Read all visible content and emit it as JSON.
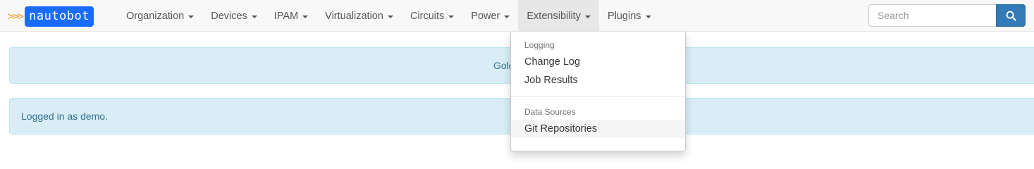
{
  "brand": {
    "chevrons": ">>>",
    "name": "nautobot"
  },
  "nav": {
    "items": [
      {
        "label": "Organization"
      },
      {
        "label": "Devices"
      },
      {
        "label": "IPAM"
      },
      {
        "label": "Virtualization"
      },
      {
        "label": "Circuits"
      },
      {
        "label": "Power"
      },
      {
        "label": "Extensibility"
      },
      {
        "label": "Plugins"
      }
    ]
  },
  "search": {
    "placeholder": "Search"
  },
  "alerts": {
    "banner_text": "Gold",
    "login_text": "Logged in as demo."
  },
  "dropdown": {
    "sections": [
      {
        "header": "Logging",
        "items": [
          "Change Log",
          "Job Results"
        ]
      },
      {
        "header": "Data Sources",
        "items": [
          "Git Repositories"
        ]
      }
    ]
  },
  "colors": {
    "brand_blue": "#1a6cff",
    "brand_orange": "#f7931e",
    "alert_bg": "#d9edf7",
    "search_button": "#337ab7"
  }
}
